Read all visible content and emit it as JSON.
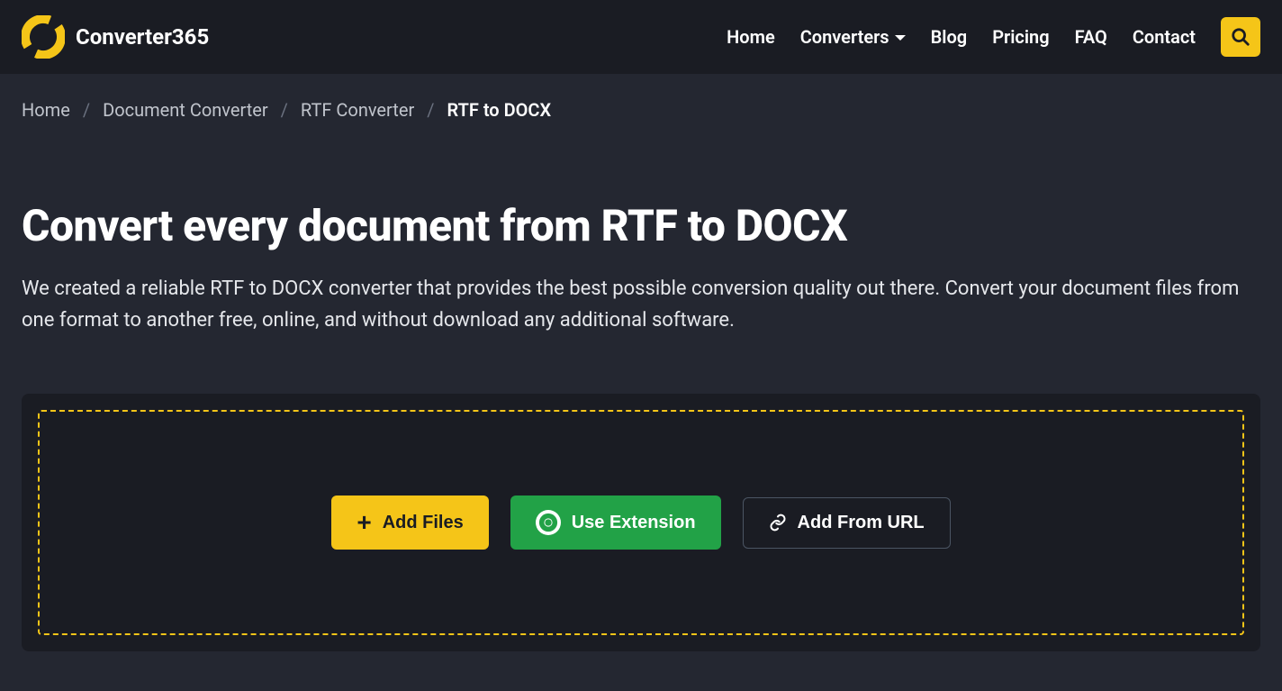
{
  "header": {
    "logo_text": "Converter365",
    "nav": {
      "home": "Home",
      "converters": "Converters",
      "blog": "Blog",
      "pricing": "Pricing",
      "faq": "FAQ",
      "contact": "Contact"
    }
  },
  "breadcrumb": {
    "home": "Home",
    "document_converter": "Document Converter",
    "rtf_converter": "RTF Converter",
    "current": "RTF to DOCX"
  },
  "hero": {
    "title": "Convert every document from RTF to DOCX",
    "description": "We created a reliable RTF to DOCX converter that provides the best possible conversion quality out there. Convert your document files from one format to another free, online, and without download any additional software."
  },
  "upload": {
    "add_files": "Add Files",
    "use_extension": "Use Extension",
    "add_from_url": "Add From URL"
  },
  "colors": {
    "accent": "#f5c518",
    "success": "#22a247",
    "bg_dark": "#1a1c23",
    "bg_page": "#242731"
  }
}
